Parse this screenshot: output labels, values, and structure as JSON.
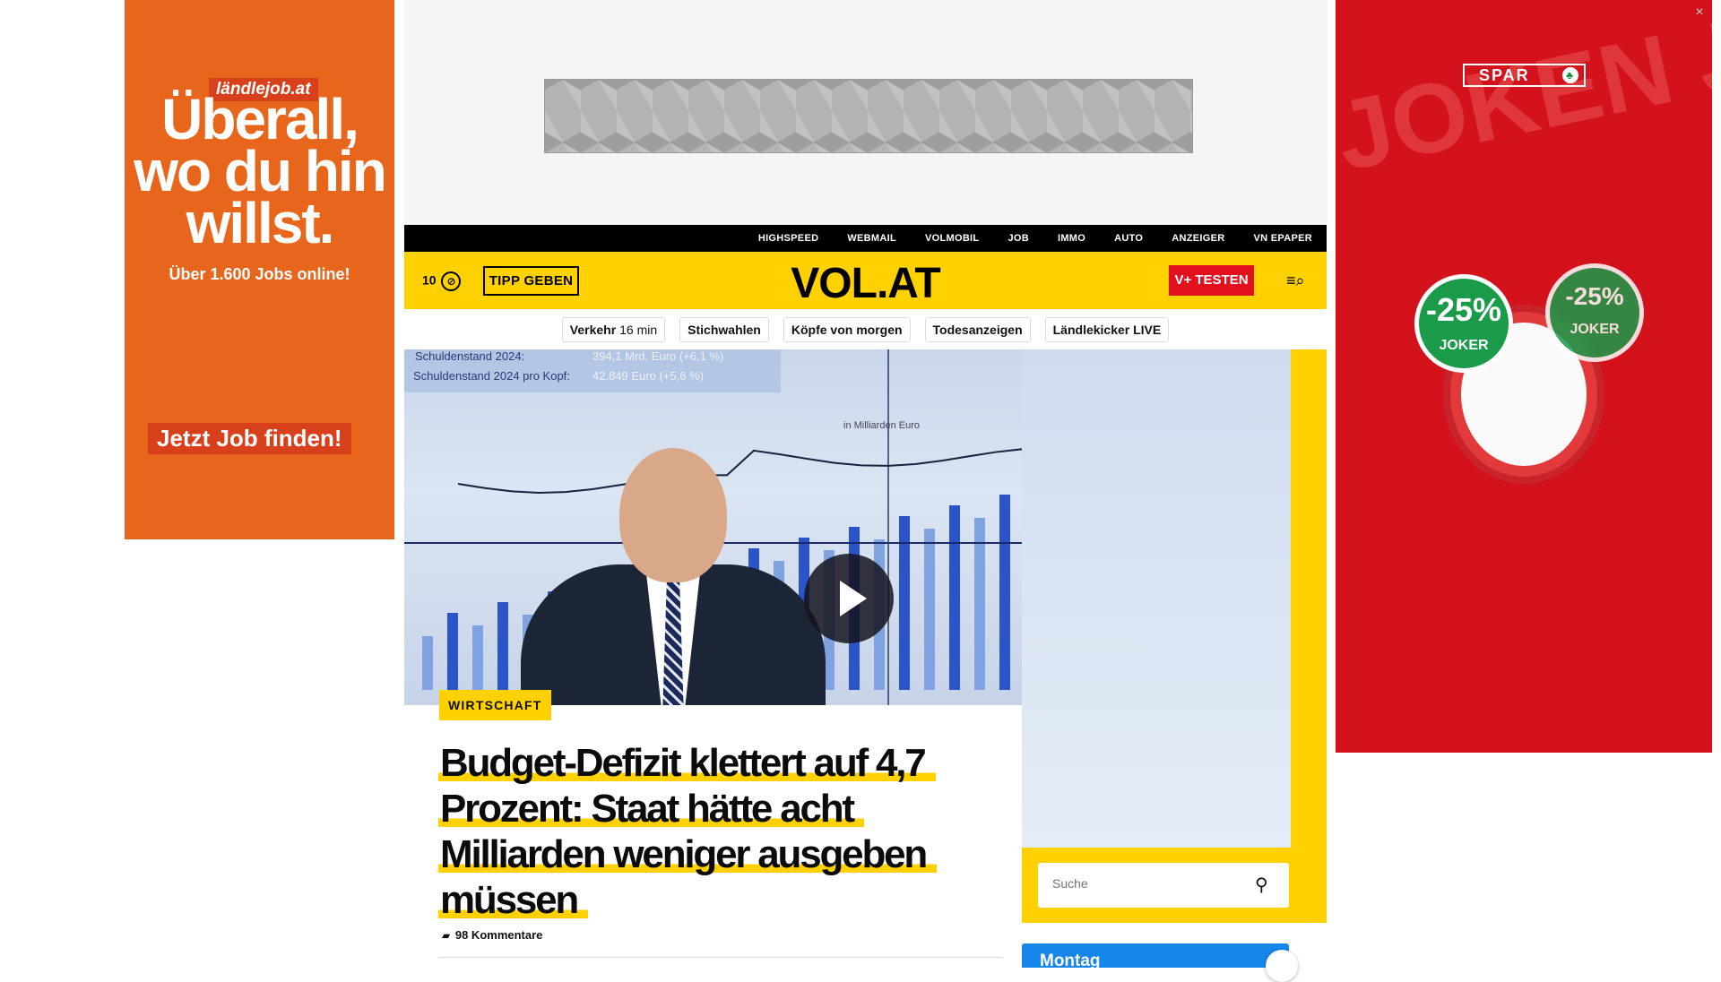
{
  "ad_left": {
    "brand": "ländlejob.at",
    "headline_lines": [
      "Überall,",
      "wo du hin",
      "willst."
    ],
    "subline": "Über 1.600 Jobs online!",
    "cta": "Jetzt Job finden!",
    "color": "#e8661c"
  },
  "ad_right": {
    "brand": "SPAR",
    "badge1_value": "-25%",
    "badge1_label": "JOKER",
    "badge2_value": "-25%",
    "badge2_label": "JOKER",
    "background_text": "JOKEN JOKEN JOKEN",
    "color": "#d4121c",
    "close_icon": "×"
  },
  "topnav": {
    "items": [
      "HIGHSPEED",
      "WEBMAIL",
      "VOLMOBIL",
      "JOB",
      "IMMO",
      "AUTO",
      "ANZEIGER",
      "VN EPAPER"
    ]
  },
  "header": {
    "count": "10",
    "count_icon": "⊘",
    "tipp_label": "TIPP GEBEN",
    "logo": "VOL.AT",
    "vplus_label": "V+ TESTEN",
    "menu_icon": "≡⌕",
    "accent": "#ffd100"
  },
  "quicklinks": [
    {
      "label": "Verkehr",
      "meta": "16 min"
    },
    {
      "label": "Stichwahlen",
      "meta": ""
    },
    {
      "label": "Köpfe von morgen",
      "meta": ""
    },
    {
      "label": "Todesanzeigen",
      "meta": ""
    },
    {
      "label": "Ländlekicker LIVE",
      "meta": ""
    }
  ],
  "article": {
    "category": "WIRTSCHAFT",
    "title_lines": [
      "Budget-Defizit klettert auf 4,7",
      "Prozent: Staat hätte acht",
      "Milliarden weniger ausgeben",
      "müssen"
    ],
    "comments_icon": "▰",
    "comments": "98 Kommentare"
  },
  "video": {
    "play_icon": "play-icon",
    "chart_text": {
      "row1_label": "Schuldenstand 2024:",
      "row1_value": "394,1 Mrd. Euro (+6,1 %)",
      "row2_label": "Schuldenstand 2024 pro Kopf:",
      "row2_value": "42.849 Euro (+5,6 %)",
      "unit": "in Milliarden Euro"
    }
  },
  "sidebar": {
    "search_placeholder": "Suche",
    "search_icon": "⚲",
    "weather_day": "Montag"
  }
}
